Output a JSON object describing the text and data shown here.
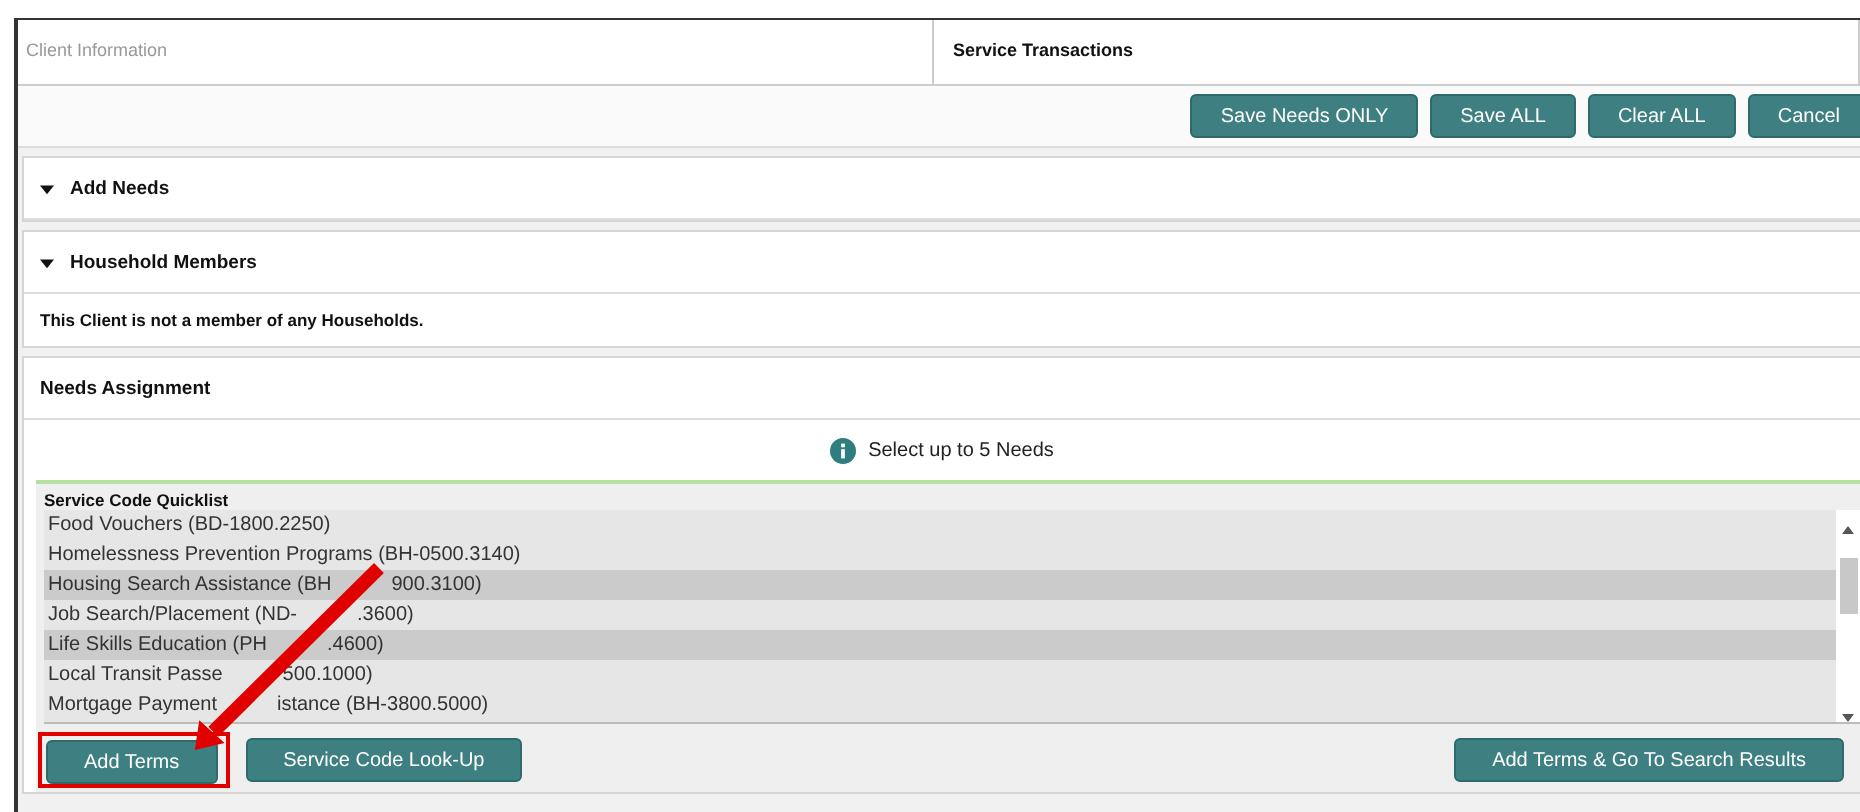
{
  "tabs": [
    {
      "label": "Client Information",
      "selected": false
    },
    {
      "label": "Service Transactions",
      "selected": true
    }
  ],
  "toolbar": {
    "buttons": [
      "Save Needs ONLY",
      "Save ALL",
      "Clear ALL",
      "Cancel"
    ]
  },
  "sections": [
    {
      "title": "Add Needs",
      "kind": "collapsible",
      "expanded": true
    },
    {
      "title": "Household Members",
      "kind": "collapsible",
      "expanded": true,
      "message": "This Client is not a member of any Households."
    },
    {
      "title": "Needs Assignment",
      "kind": "plain"
    }
  ],
  "needs_assignment": {
    "info": "Select up to 5 Needs",
    "quicklist": {
      "label": "Service Code Quicklist",
      "items": [
        {
          "parts": [
            "Food Vouchers (BD-1800.2250)"
          ],
          "selected": false
        },
        {
          "parts": [
            "Homelessness Prevention Programs (BH-0500.3140)"
          ],
          "selected": false
        },
        {
          "parts": [
            "Housing Search Assistance (BH",
            "900.3100)"
          ],
          "selected": true
        },
        {
          "parts": [
            "Job Search/Placement (ND-",
            ".3600)"
          ],
          "selected": false
        },
        {
          "parts": [
            "Life Skills Education (PH",
            ".4600)"
          ],
          "selected": true
        },
        {
          "parts": [
            "Local Transit Passe",
            "500.1000)"
          ],
          "selected": false
        },
        {
          "parts": [
            "Mortgage Payment",
            "istance (BH-3800.5000)"
          ],
          "selected": false
        }
      ]
    },
    "buttons_left": [
      {
        "label": "Add Terms",
        "highlighted": true
      },
      {
        "label": "Service Code Look-Up",
        "highlighted": false
      }
    ],
    "buttons_right": [
      {
        "label": "Add Terms & Go To Search Results",
        "highlighted": false
      }
    ]
  }
}
